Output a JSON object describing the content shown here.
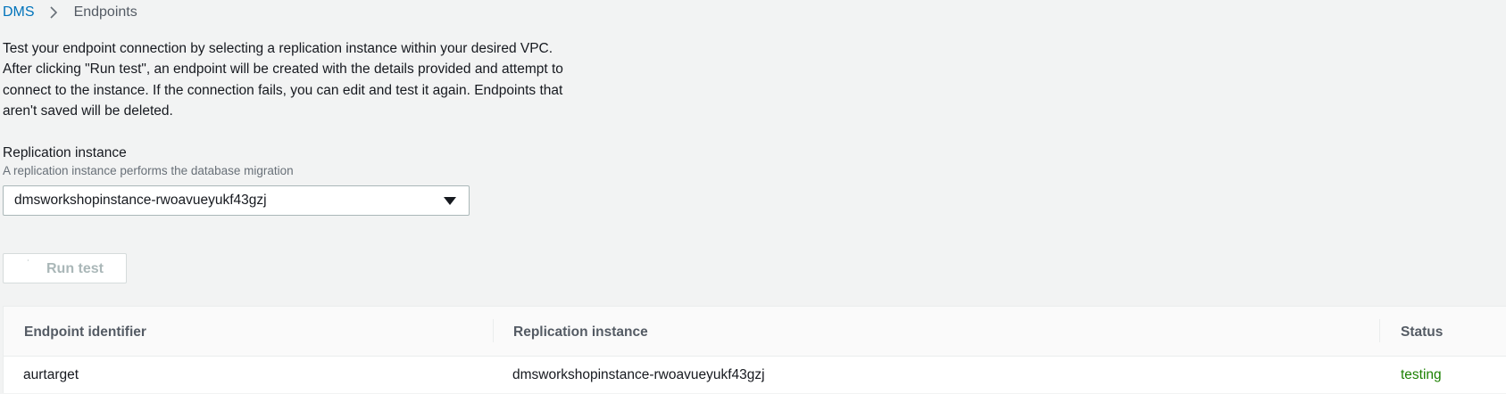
{
  "breadcrumb": {
    "items": [
      {
        "label": "DMS"
      },
      {
        "label": "Endpoints"
      }
    ]
  },
  "description": {
    "lines": [
      "Test your endpoint connection by selecting a replication instance within your desired VPC.",
      "After clicking \"Run test\", an endpoint will be created with the details provided and attempt to",
      "connect to the instance. If the connection fails, you can edit and test it again. Endpoints that",
      "aren't saved will be deleted."
    ]
  },
  "replication_field": {
    "label": "Replication instance",
    "description": "A replication instance performs the database migration",
    "selected_value": "dmsworkshopinstance-rwoavueyukf43gzj"
  },
  "run_test": {
    "label": "Run test",
    "icon": "loading-spinner-icon",
    "disabled": true
  },
  "table": {
    "columns": [
      {
        "label": "Endpoint identifier"
      },
      {
        "label": "Replication instance"
      },
      {
        "label": "Status"
      }
    ],
    "rows": [
      {
        "endpoint_identifier": "aurtarget",
        "replication_instance": "dmsworkshopinstance-rwoavueyukf43gzj",
        "status": "testing"
      }
    ]
  },
  "colors": {
    "link": "#0073bb",
    "status_testing": "#1d8102",
    "disabled_text": "#aab7b8",
    "page_background": "#f2f3f3"
  }
}
